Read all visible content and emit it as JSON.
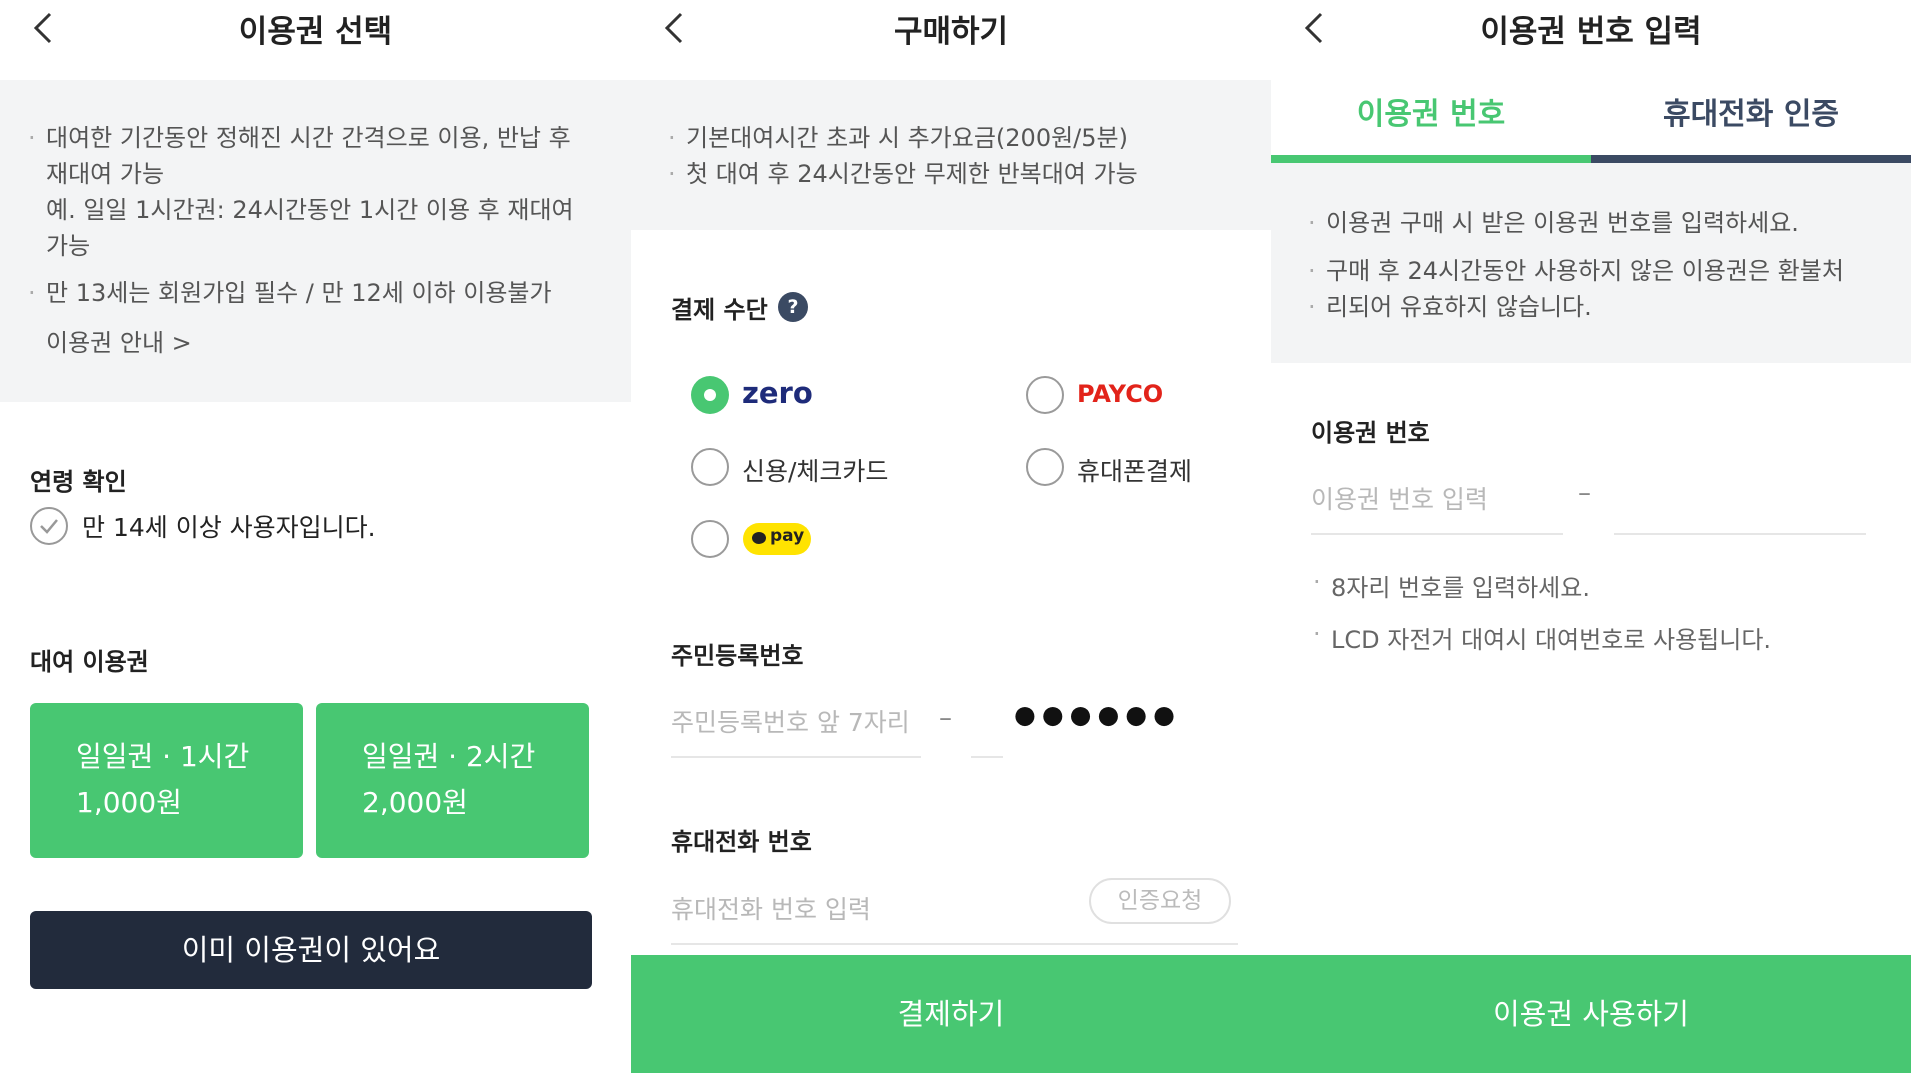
{
  "panel1": {
    "title": "이용권 선택",
    "info_bullets": [
      "대여한 기간동안 정해진 시간 간격으로 이용, 반납 후",
      "재대여 가능",
      "예. 일일 1시간권: 24시간동안 1시간 이용 후 재대여",
      "가능"
    ],
    "info_bullet2": "만 13세는 회원가입 필수 / 만 12세 이하 이용불가",
    "guide_link": "이용권 안내 >",
    "age_label": "연령 확인",
    "age_check_text": "만 14세 이상 사용자입니다.",
    "rental_label": "대여 이용권",
    "tickets": [
      {
        "name": "일일권 · 1시간",
        "price": "1,000원"
      },
      {
        "name": "일일권 · 2시간",
        "price": "2,000원"
      }
    ],
    "have_ticket_button": "이미 이용권이 있어요"
  },
  "panel2": {
    "title": "구매하기",
    "info_line1": "기본대여시간 초과 시 추가요금(200원/5분)",
    "info_line2": "첫 대여 후 24시간동안 무제한 반복대여 가능",
    "payment_label": "결제 수단",
    "payment_options": {
      "zero": "zero",
      "payco": "PAYCO",
      "card": "신용/체크카드",
      "phone": "휴대폰결제",
      "kakao": "pay"
    },
    "selected_payment": "zero",
    "rrn_label": "주민등록번호",
    "rrn_placeholder": "주민등록번호 앞 7자리",
    "rrn_masked": "●●●●●●",
    "phone_label": "휴대전화 번호",
    "phone_placeholder": "휴대전화 번호 입력",
    "verify_button": "인증요청",
    "pay_button": "결제하기",
    "colors": {
      "green": "#48c772",
      "payco": "#e2231a",
      "kakao": "#ffe300",
      "zero_blue": "#1e2b7a"
    }
  },
  "panel3": {
    "title": "이용권 번호 입력",
    "tab_ticket": "이용권 번호",
    "tab_phone": "휴대전화 인증",
    "info_line1": "이용권 구매 시 받은 이용권 번호를 입력하세요.",
    "info_line2a": "구매 후 24시간동안 사용하지 않은 이용권은 환불처",
    "info_line2b": "리되어 유효하지 않습니다.",
    "number_label": "이용권 번호",
    "number_placeholder": "이용권 번호 입력",
    "dash": "–",
    "note1": "8자리 번호를 입력하세요.",
    "note2": "LCD 자전거 대여시 대여번호로 사용됩니다.",
    "use_button": "이용권 사용하기"
  }
}
